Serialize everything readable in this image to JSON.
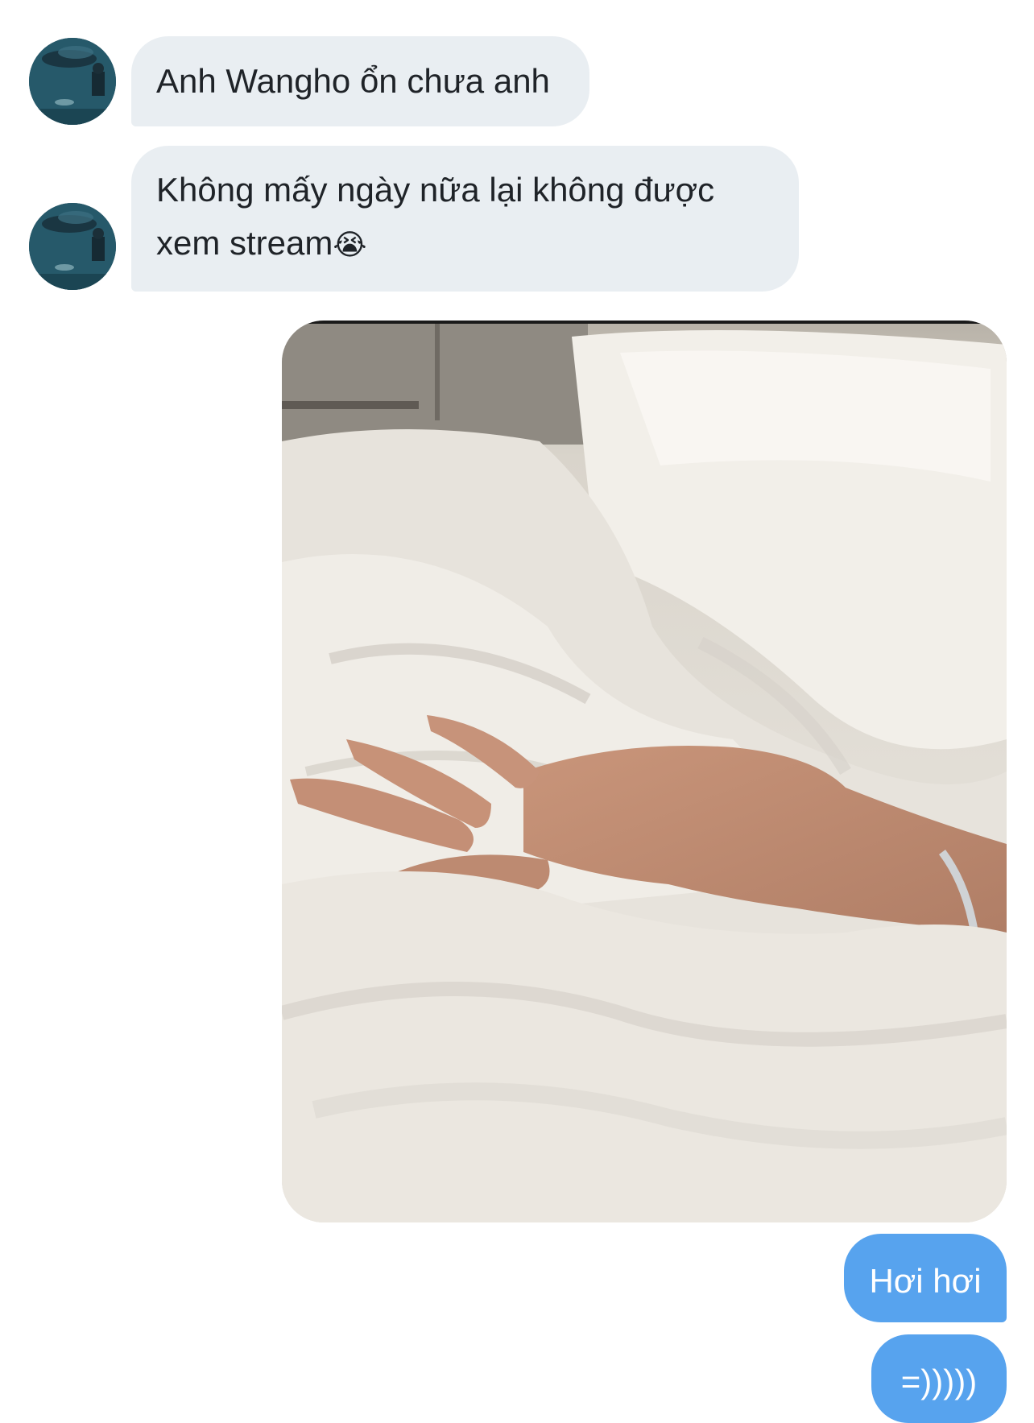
{
  "conversation": {
    "incoming": [
      {
        "text": "Anh Wangho ổn chưa anh"
      },
      {
        "text": "Không mấy ngày nữa lại không được",
        "text2": "xem stream",
        "emoji": "😭"
      }
    ],
    "outgoing": [
      {
        "text": "Hơi hơi"
      },
      {
        "text": "=)))))"
      }
    ]
  },
  "colors": {
    "incoming_bubble": "#e9eef2",
    "outgoing_bubble": "#57a3ee"
  }
}
